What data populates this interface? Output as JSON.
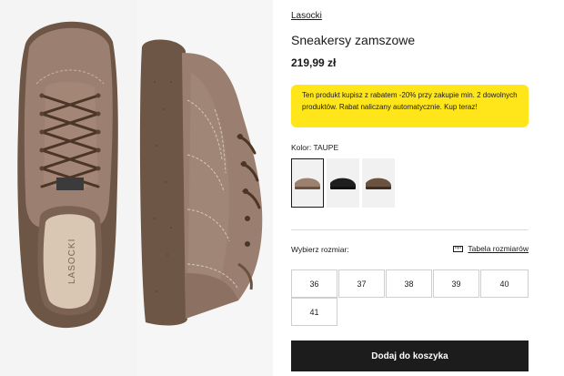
{
  "product": {
    "brand": "Lasocki",
    "title": "Sneakersy zamszowe",
    "price": "219,99 zł",
    "promo": "Ten produkt kupisz z rabatem -20% przy zakupie min. 2 dowolnych produktów. Rabat naliczany automatycznie. Kup teraz!",
    "insole_logo": "LASOCKI"
  },
  "color": {
    "label": "Kolor:",
    "value": "TAUPE",
    "swatches": [
      {
        "color": "#9c8170",
        "sole": "#6b5240",
        "selected": true
      },
      {
        "color": "#1e1e1e",
        "sole": "#111111",
        "selected": false
      },
      {
        "color": "#6a5340",
        "sole": "#3d2e22",
        "selected": false
      }
    ]
  },
  "sizes": {
    "prompt": "Wybierz rozmiar:",
    "table_link": "Tabela rozmiarów",
    "options": [
      "36",
      "37",
      "38",
      "39",
      "40",
      "41"
    ]
  },
  "cart": {
    "button_label": "Dodaj do koszyka"
  },
  "icons": {
    "size_table": "ruler-icon"
  },
  "colors": {
    "accent_yellow": "#ffe61a",
    "button_dark": "#1c1c1c",
    "suede": "#9a7f70",
    "sole": "#6e5646"
  }
}
